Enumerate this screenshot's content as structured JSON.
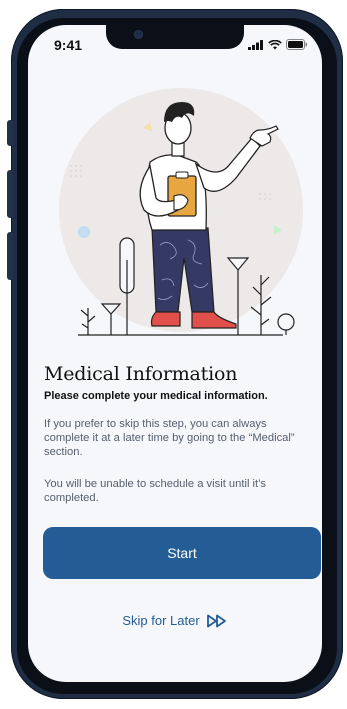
{
  "status_bar": {
    "time": "9:41"
  },
  "content": {
    "title": "Medical Information",
    "subtitle": "Please complete your medical information.",
    "paragraph1": "If you prefer to skip this step, you can always complete it at a later time by going to the “Medical” section.",
    "paragraph2": "You will be unable to schedule a visit until it’s completed."
  },
  "actions": {
    "start_label": "Start",
    "skip_label": "Skip for Later"
  },
  "colors": {
    "primary": "#245c96",
    "background": "#f6f7fa",
    "illustration_shoes": "#e2504c",
    "illustration_clipboard": "#e7a63f",
    "illustration_pants": "#343a63"
  },
  "icons": [
    "signal-icon",
    "wifi-icon",
    "battery-icon",
    "fast-forward-icon"
  ]
}
